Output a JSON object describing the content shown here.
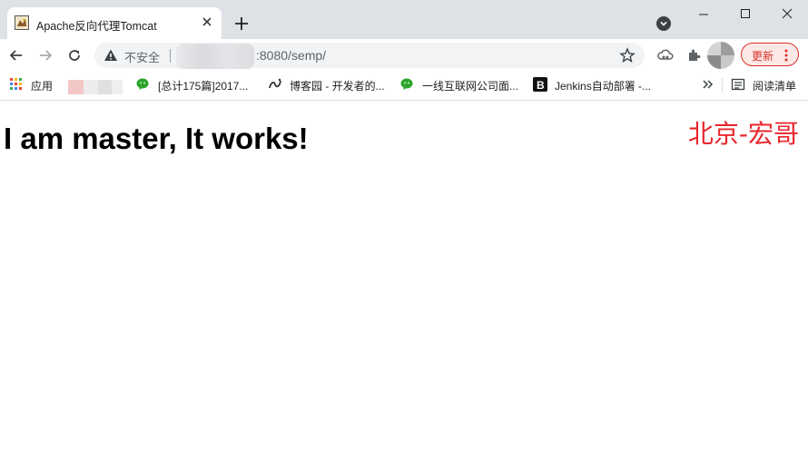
{
  "browser": {
    "tab": {
      "title": "Apache反向代理Tomcat",
      "favicon": "tomcat-favicon"
    },
    "omnibox": {
      "security_label": "不安全",
      "url_visible": ":8080/semp/"
    },
    "update_button": {
      "label": "更新"
    },
    "bookmarks": [
      {
        "label": "应用",
        "icon": "apps-grid-icon"
      },
      {
        "label": "[总计175篇]2017...",
        "icon": "wechat-icon"
      },
      {
        "label": "博客园 - 开发者的...",
        "icon": "cnblogs-icon"
      },
      {
        "label": "一线互联网公司面...",
        "icon": "wechat-icon"
      },
      {
        "label": "Jenkins自动部署 -...",
        "icon": "bold-b-icon"
      }
    ],
    "reading_list": {
      "label": "阅读清单"
    }
  },
  "page": {
    "heading": "I am master, It works!",
    "watermark": "北京-宏哥"
  },
  "colors": {
    "tab_strip": "#dee1e6",
    "update_accent": "#d93025",
    "watermark": "#e8262c"
  }
}
